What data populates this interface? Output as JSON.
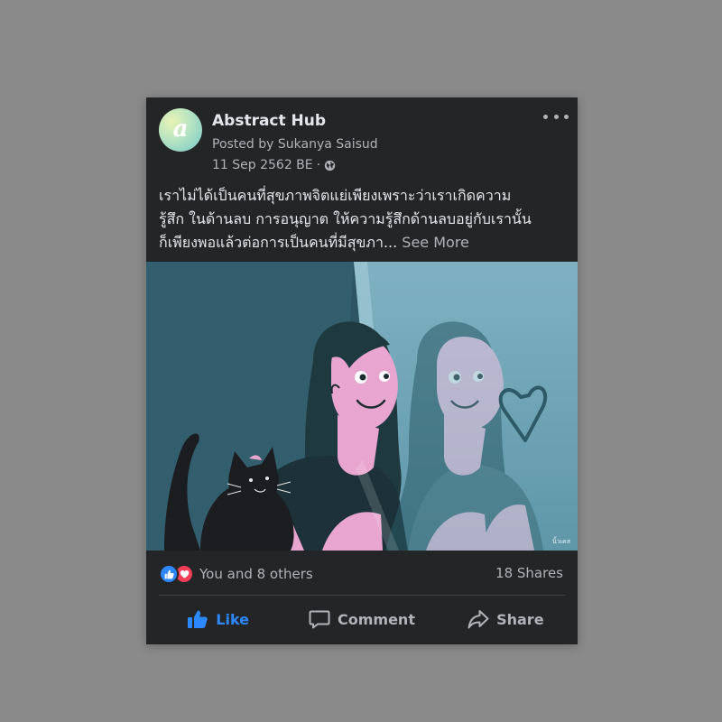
{
  "post": {
    "page_name": "Abstract Hub",
    "avatar_letter": "a",
    "posted_by": "Posted by Sukanya Saisud",
    "date": "11 Sep 2562 BE",
    "meta_separator": "·",
    "privacy_icon": "globe-icon",
    "menu_icon": "more-horizontal-icon",
    "text_lines": [
      "เราไม่ได้เป็นคนที่สุขภาพจิตแย่เพียงเพราะว่าเราเกิดความ",
      "รู้สึก ในด้านลบ การอนุญาต ให้ความรู้สึกด้านลบอยู่กับเรานั้น",
      "ก็เพียงพอแล้วต่อการเป็นคนที่มีสุขภา..."
    ],
    "see_more": "See More",
    "image_signature": "นิ้วเคส"
  },
  "stats": {
    "reaction_icons": [
      "like-reaction-icon",
      "love-reaction-icon"
    ],
    "reactions_text": "You and 8 others",
    "shares_text": "18 Shares"
  },
  "actions": {
    "like_label": "Like",
    "comment_label": "Comment",
    "share_label": "Share"
  },
  "colors": {
    "card_bg": "#242526",
    "page_bg": "#8a8a8a",
    "like_blue": "#2d88ff",
    "love_red": "#f33e58",
    "text_primary": "#e4e6eb",
    "text_secondary": "#b0b3b8"
  }
}
